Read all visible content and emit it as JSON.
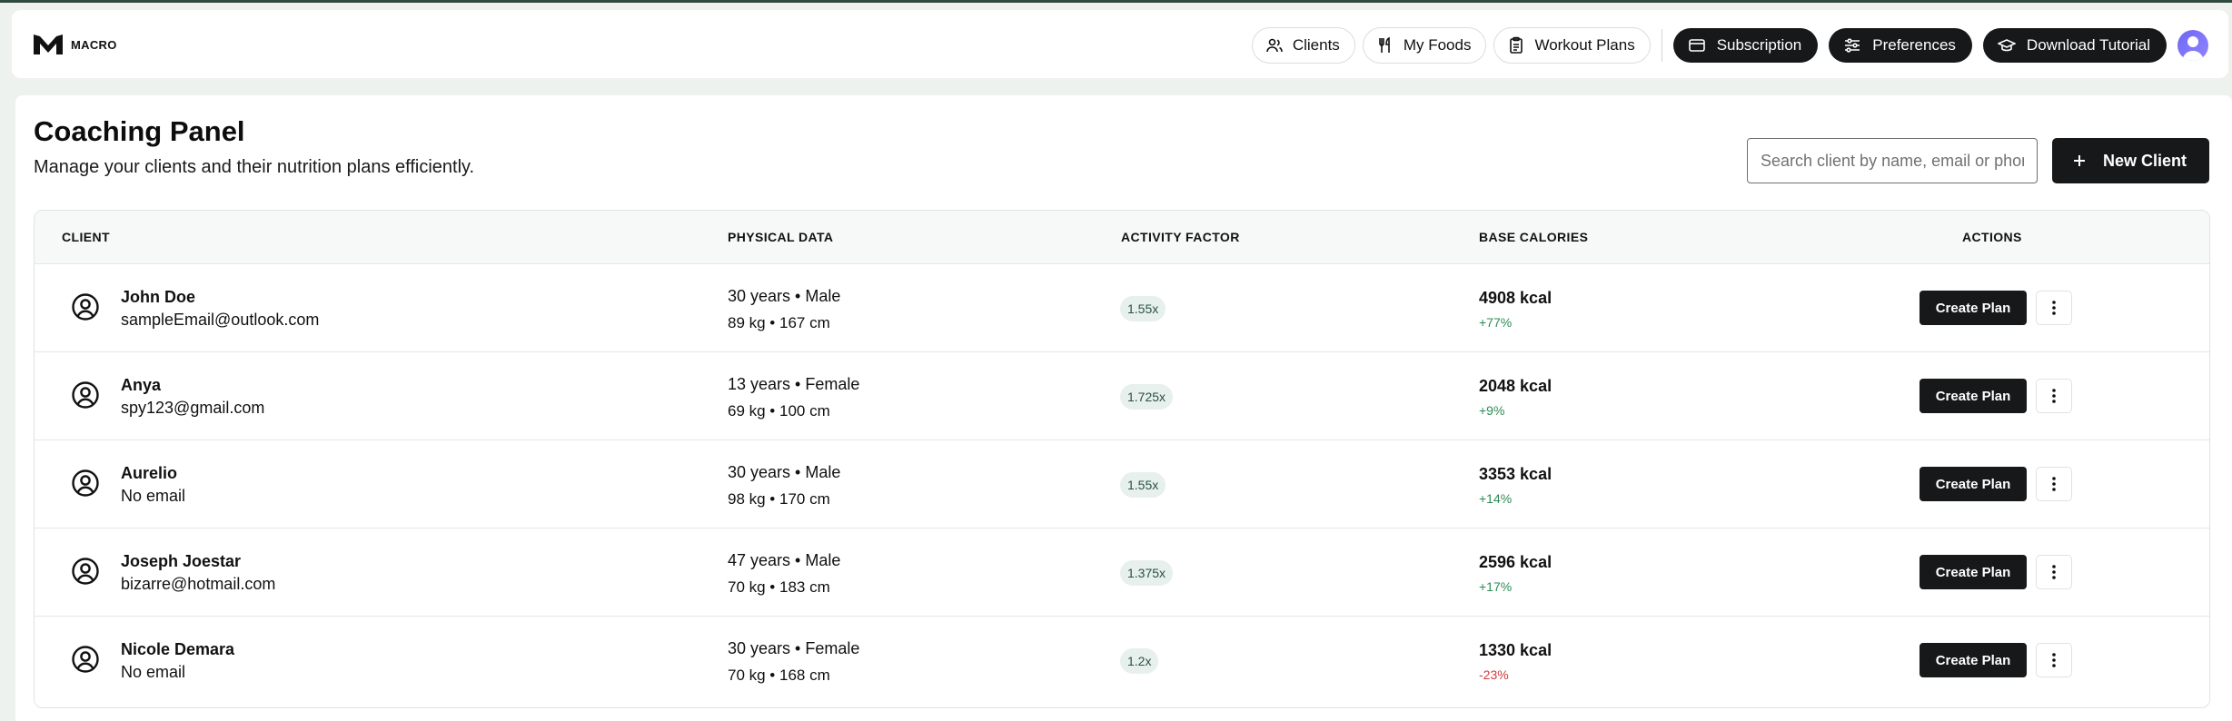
{
  "app": {
    "name": "MACRO",
    "logo_icon": "macro-logo"
  },
  "nav": {
    "items": [
      {
        "label": "Clients",
        "icon": "users-icon"
      },
      {
        "label": "My Foods",
        "icon": "utensils-icon"
      },
      {
        "label": "Workout Plans",
        "icon": "clipboard-icon"
      }
    ],
    "actions": [
      {
        "label": "Subscription",
        "icon": "credit-card-icon"
      },
      {
        "label": "Preferences",
        "icon": "sliders-icon"
      },
      {
        "label": "Download Tutorial",
        "icon": "graduation-cap-icon"
      }
    ],
    "avatar_icon": "user-avatar"
  },
  "page": {
    "title": "Coaching Panel",
    "subtitle": "Manage your clients and their nutrition plans efficiently."
  },
  "search": {
    "placeholder": "Search client by name, email or phone",
    "value": ""
  },
  "new_client_label": "New Client",
  "table": {
    "headers": {
      "client": "CLIENT",
      "physical": "PHYSICAL DATA",
      "activity": "ACTIVITY FACTOR",
      "calories": "BASE CALORIES",
      "actions": "ACTIONS"
    },
    "rows": [
      {
        "name": "John Doe",
        "email": "sampleEmail@outlook.com",
        "age_sex": "30 years • Male",
        "weight_height": "89 kg • 167 cm",
        "activity": "1.55x",
        "calories": "4908 kcal",
        "change": "+77%",
        "change_dir": "up",
        "action": "Create Plan"
      },
      {
        "name": "Anya",
        "email": "spy123@gmail.com",
        "age_sex": "13 years • Female",
        "weight_height": "69 kg • 100 cm",
        "activity": "1.725x",
        "calories": "2048 kcal",
        "change": "+9%",
        "change_dir": "up",
        "action": "Create Plan"
      },
      {
        "name": "Aurelio",
        "email": "No email",
        "age_sex": "30 years • Male",
        "weight_height": "98 kg • 170 cm",
        "activity": "1.55x",
        "calories": "3353 kcal",
        "change": "+14%",
        "change_dir": "up",
        "action": "Create Plan"
      },
      {
        "name": "Joseph Joestar",
        "email": "bizarre@hotmail.com",
        "age_sex": "47 years • Male",
        "weight_height": "70 kg • 183 cm",
        "activity": "1.375x",
        "calories": "2596 kcal",
        "change": "+17%",
        "change_dir": "up",
        "action": "Create Plan"
      },
      {
        "name": "Nicole Demara",
        "email": "No email",
        "age_sex": "30 years • Female",
        "weight_height": "70 kg • 168 cm",
        "activity": "1.2x",
        "calories": "1330 kcal",
        "change": "-23%",
        "change_dir": "down",
        "action": "Create Plan"
      }
    ]
  },
  "colors": {
    "dark": "#16181a",
    "positive": "#2e8b55",
    "negative": "#d23b3b",
    "badge_bg": "#e7f0ec",
    "avatar": "#7b72f6"
  }
}
